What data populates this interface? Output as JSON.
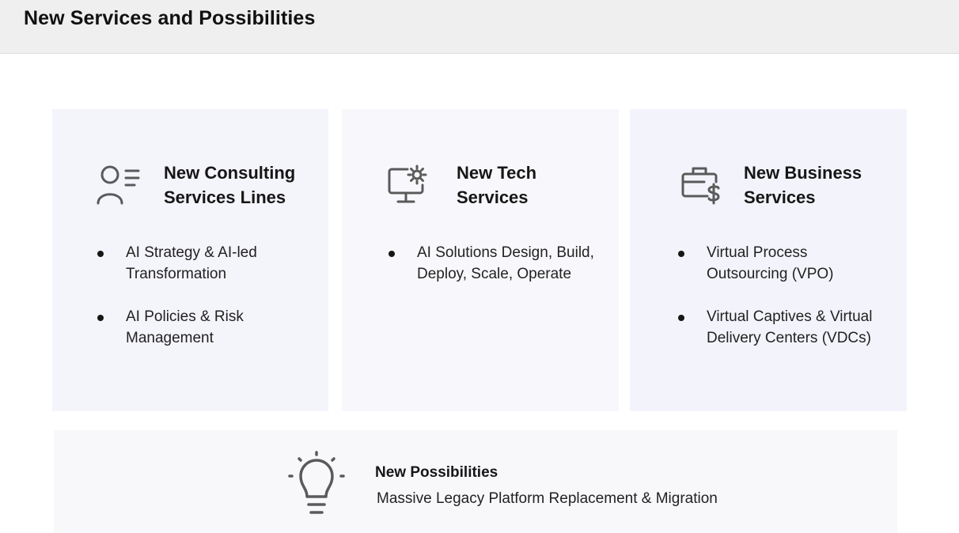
{
  "header": {
    "title": "New Services and Possibilities"
  },
  "cards": [
    {
      "icon": "person-list-icon",
      "title": "New Consulting Services Lines",
      "bullets": [
        "AI Strategy & AI-led Transformation",
        "AI Policies & Risk Management"
      ]
    },
    {
      "icon": "monitor-gear-icon",
      "title": "New Tech Services",
      "bullets": [
        "AI Solutions Design, Build, Deploy, Scale, Operate"
      ]
    },
    {
      "icon": "briefcase-dollar-icon",
      "title": "New Business Services",
      "bullets": [
        "Virtual Process Outsourcing (VPO)",
        "Virtual Captives & Virtual Delivery Centers (VDCs)"
      ]
    }
  ],
  "possibilities": {
    "icon": "lightbulb-icon",
    "title": "New Possibilities",
    "text": "Massive Legacy Platform Replacement & Migration"
  },
  "colors": {
    "icon_stroke": "#5a5a5a",
    "header_bg": "#efefef",
    "card_bg": "#f4f4fb"
  }
}
